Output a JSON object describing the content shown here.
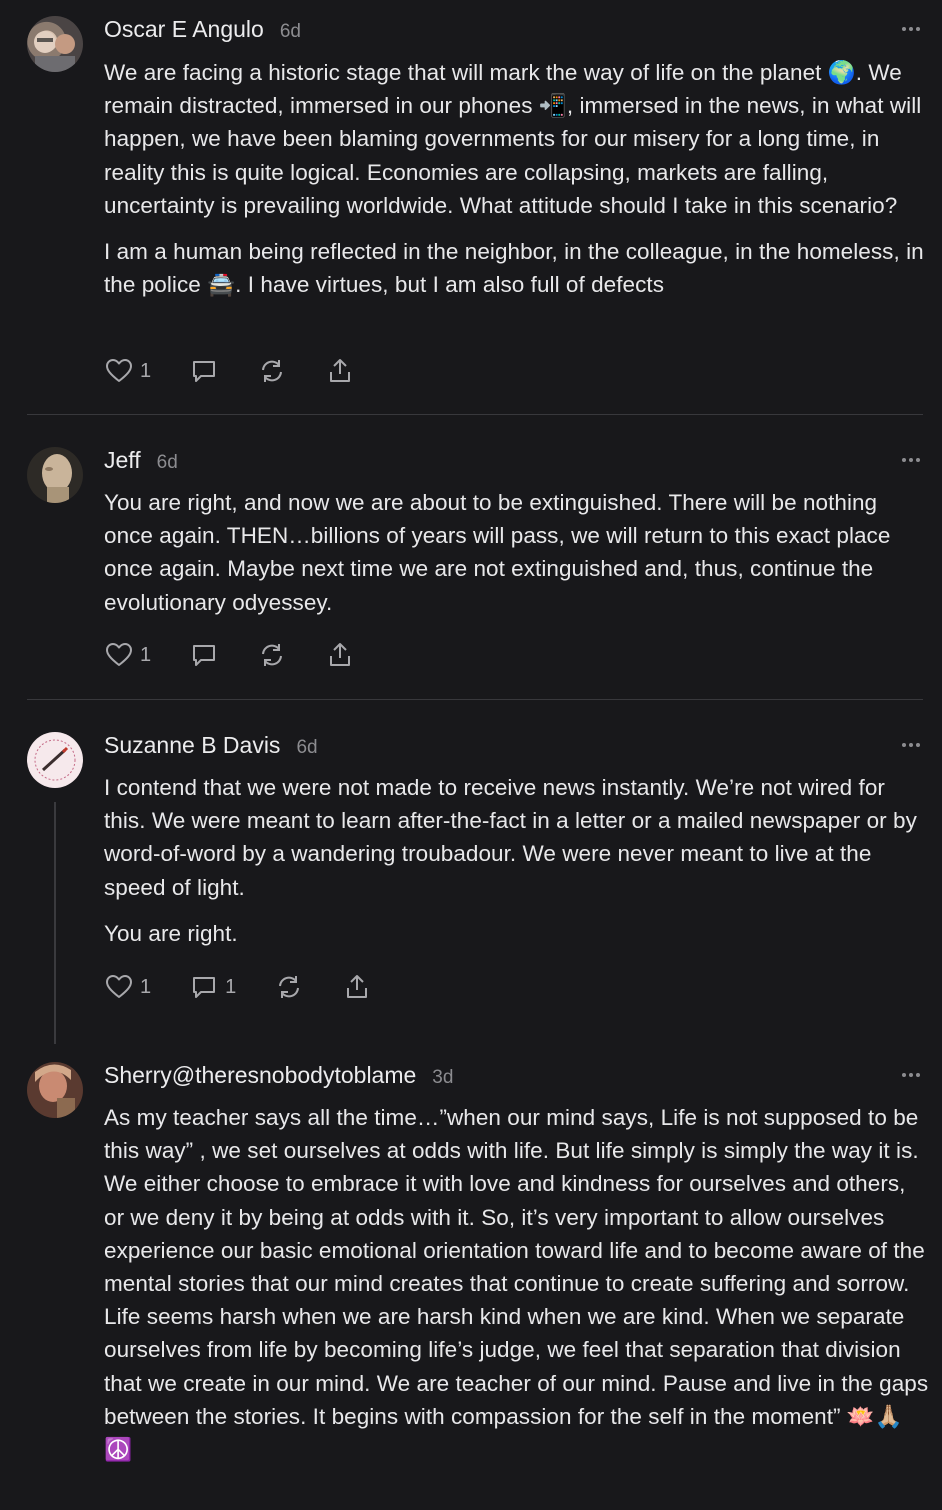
{
  "comments": [
    {
      "author": "Oscar E Angulo",
      "age": "6d",
      "paragraphs": [
        "We are facing a historic stage that will mark the way of life on the planet 🌍. We remain distracted, immersed in our phones 📲, immersed in the news, in what will happen, we have been blaming governments for our misery for a long time, in reality this is quite logical. Economies are collapsing, markets are falling, uncertainty is prevailing worldwide. What attitude should I take in this scenario?",
        "I am a human being reflected in the neighbor, in the colleague, in the homeless, in the police 🚔. I have virtues, but I am also full of defects"
      ],
      "likes": "1",
      "replies": ""
    },
    {
      "author": "Jeff",
      "age": "6d",
      "paragraphs": [
        "You are right, and now we are about to be extinguished. There will be nothing once again. THEN…billions of years will pass, we will return to this exact place once again. Maybe next time we are not extinguished and, thus, continue the evolutionary odyessey."
      ],
      "likes": "1",
      "replies": ""
    },
    {
      "author": "Suzanne B Davis",
      "age": "6d",
      "avatar_text": "SOMEONE TO TALK TO",
      "paragraphs": [
        "I contend that we were not made to receive news instantly. We’re not wired for this. We were meant to learn after-the-fact in a letter or a mailed newspaper or by word-of-word by a wandering troubadour. We were never meant to live at the speed of light.",
        "You are right."
      ],
      "likes": "1",
      "replies": "1"
    },
    {
      "author": "Sherry@theresnobodytoblame",
      "age": "3d",
      "paragraphs": [
        "As my teacher says all the time…”when our mind says, Life is not supposed to be this way” , we set ourselves at odds with life. But life simply is simply the way it is. We either choose to embrace it with love and kindness for ourselves and others, or we deny it by being at odds with it. So, it’s very important to allow ourselves experience our basic emotional orientation toward life and to become aware of the mental stories that our mind creates that continue to create suffering and sorrow. Life seems harsh when we are harsh kind when we are kind. When we separate ourselves from life by becoming life’s judge, we feel that separation that division that we create in our mind. We are teacher of our mind. Pause and live in the gaps between the stories. It begins with compassion for the self in the moment” 🪷🙏🏼☮️"
      ]
    }
  ],
  "icons": [
    "heart-icon",
    "comment-icon",
    "restack-icon",
    "share-icon",
    "more-icon"
  ],
  "colors": {
    "background": "#18181b",
    "text": "#e8e8ea",
    "muted": "#8c8c90",
    "divider": "#38383c"
  }
}
